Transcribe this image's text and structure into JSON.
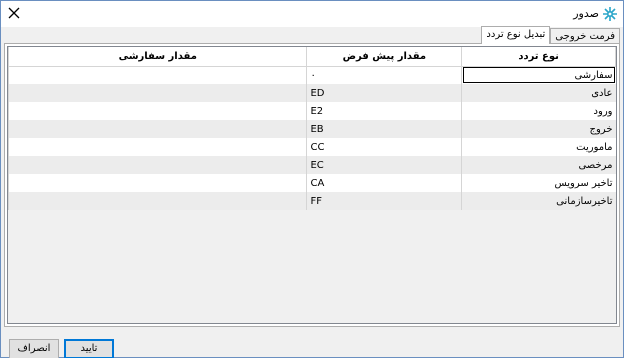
{
  "window": {
    "title": "صدور",
    "title_icon": "app-gear-icon",
    "close_icon": "close-icon"
  },
  "tabs": [
    {
      "label": "فرمت خروجی",
      "active": false
    },
    {
      "label": "تبدیل نوع تردد",
      "active": true
    }
  ],
  "grid": {
    "columns": [
      "نوع تردد",
      "مقدار پیش فرض",
      "مقدار سفارشی"
    ],
    "rows": [
      {
        "type": "سفارشی",
        "default": "۰",
        "custom": ""
      },
      {
        "type": "عادی",
        "default": "ED",
        "custom": ""
      },
      {
        "type": "ورود",
        "default": "E2",
        "custom": ""
      },
      {
        "type": "خروج",
        "default": "EB",
        "custom": ""
      },
      {
        "type": "ماموریت",
        "default": "CC",
        "custom": ""
      },
      {
        "type": "مرخصی",
        "default": "EC",
        "custom": ""
      },
      {
        "type": "تاخیر سرویس",
        "default": "CA",
        "custom": ""
      },
      {
        "type": "تاخیرسازمانی",
        "default": "FF",
        "custom": ""
      }
    ]
  },
  "buttons": {
    "ok": "تایید",
    "cancel": "انصراف"
  },
  "colors": {
    "selected_button_border": "#0078d7",
    "row_alt": "#ececec",
    "window_border": "#6a8fc0"
  }
}
